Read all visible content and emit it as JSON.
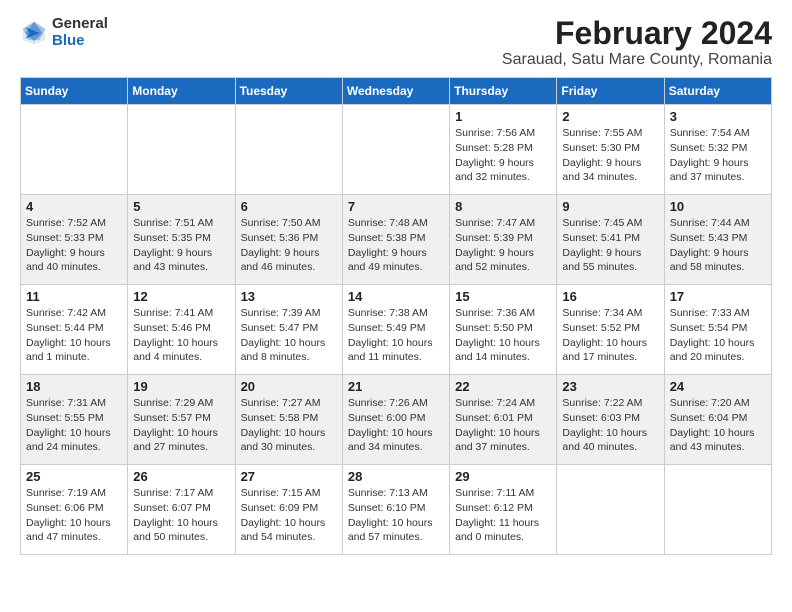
{
  "logo": {
    "general": "General",
    "blue": "Blue"
  },
  "title": "February 2024",
  "subtitle": "Sarauad, Satu Mare County, Romania",
  "days_of_week": [
    "Sunday",
    "Monday",
    "Tuesday",
    "Wednesday",
    "Thursday",
    "Friday",
    "Saturday"
  ],
  "weeks": [
    [
      {
        "day": "",
        "info": ""
      },
      {
        "day": "",
        "info": ""
      },
      {
        "day": "",
        "info": ""
      },
      {
        "day": "",
        "info": ""
      },
      {
        "day": "1",
        "info": "Sunrise: 7:56 AM\nSunset: 5:28 PM\nDaylight: 9 hours\nand 32 minutes."
      },
      {
        "day": "2",
        "info": "Sunrise: 7:55 AM\nSunset: 5:30 PM\nDaylight: 9 hours\nand 34 minutes."
      },
      {
        "day": "3",
        "info": "Sunrise: 7:54 AM\nSunset: 5:32 PM\nDaylight: 9 hours\nand 37 minutes."
      }
    ],
    [
      {
        "day": "4",
        "info": "Sunrise: 7:52 AM\nSunset: 5:33 PM\nDaylight: 9 hours\nand 40 minutes."
      },
      {
        "day": "5",
        "info": "Sunrise: 7:51 AM\nSunset: 5:35 PM\nDaylight: 9 hours\nand 43 minutes."
      },
      {
        "day": "6",
        "info": "Sunrise: 7:50 AM\nSunset: 5:36 PM\nDaylight: 9 hours\nand 46 minutes."
      },
      {
        "day": "7",
        "info": "Sunrise: 7:48 AM\nSunset: 5:38 PM\nDaylight: 9 hours\nand 49 minutes."
      },
      {
        "day": "8",
        "info": "Sunrise: 7:47 AM\nSunset: 5:39 PM\nDaylight: 9 hours\nand 52 minutes."
      },
      {
        "day": "9",
        "info": "Sunrise: 7:45 AM\nSunset: 5:41 PM\nDaylight: 9 hours\nand 55 minutes."
      },
      {
        "day": "10",
        "info": "Sunrise: 7:44 AM\nSunset: 5:43 PM\nDaylight: 9 hours\nand 58 minutes."
      }
    ],
    [
      {
        "day": "11",
        "info": "Sunrise: 7:42 AM\nSunset: 5:44 PM\nDaylight: 10 hours\nand 1 minute."
      },
      {
        "day": "12",
        "info": "Sunrise: 7:41 AM\nSunset: 5:46 PM\nDaylight: 10 hours\nand 4 minutes."
      },
      {
        "day": "13",
        "info": "Sunrise: 7:39 AM\nSunset: 5:47 PM\nDaylight: 10 hours\nand 8 minutes."
      },
      {
        "day": "14",
        "info": "Sunrise: 7:38 AM\nSunset: 5:49 PM\nDaylight: 10 hours\nand 11 minutes."
      },
      {
        "day": "15",
        "info": "Sunrise: 7:36 AM\nSunset: 5:50 PM\nDaylight: 10 hours\nand 14 minutes."
      },
      {
        "day": "16",
        "info": "Sunrise: 7:34 AM\nSunset: 5:52 PM\nDaylight: 10 hours\nand 17 minutes."
      },
      {
        "day": "17",
        "info": "Sunrise: 7:33 AM\nSunset: 5:54 PM\nDaylight: 10 hours\nand 20 minutes."
      }
    ],
    [
      {
        "day": "18",
        "info": "Sunrise: 7:31 AM\nSunset: 5:55 PM\nDaylight: 10 hours\nand 24 minutes."
      },
      {
        "day": "19",
        "info": "Sunrise: 7:29 AM\nSunset: 5:57 PM\nDaylight: 10 hours\nand 27 minutes."
      },
      {
        "day": "20",
        "info": "Sunrise: 7:27 AM\nSunset: 5:58 PM\nDaylight: 10 hours\nand 30 minutes."
      },
      {
        "day": "21",
        "info": "Sunrise: 7:26 AM\nSunset: 6:00 PM\nDaylight: 10 hours\nand 34 minutes."
      },
      {
        "day": "22",
        "info": "Sunrise: 7:24 AM\nSunset: 6:01 PM\nDaylight: 10 hours\nand 37 minutes."
      },
      {
        "day": "23",
        "info": "Sunrise: 7:22 AM\nSunset: 6:03 PM\nDaylight: 10 hours\nand 40 minutes."
      },
      {
        "day": "24",
        "info": "Sunrise: 7:20 AM\nSunset: 6:04 PM\nDaylight: 10 hours\nand 43 minutes."
      }
    ],
    [
      {
        "day": "25",
        "info": "Sunrise: 7:19 AM\nSunset: 6:06 PM\nDaylight: 10 hours\nand 47 minutes."
      },
      {
        "day": "26",
        "info": "Sunrise: 7:17 AM\nSunset: 6:07 PM\nDaylight: 10 hours\nand 50 minutes."
      },
      {
        "day": "27",
        "info": "Sunrise: 7:15 AM\nSunset: 6:09 PM\nDaylight: 10 hours\nand 54 minutes."
      },
      {
        "day": "28",
        "info": "Sunrise: 7:13 AM\nSunset: 6:10 PM\nDaylight: 10 hours\nand 57 minutes."
      },
      {
        "day": "29",
        "info": "Sunrise: 7:11 AM\nSunset: 6:12 PM\nDaylight: 11 hours\nand 0 minutes."
      },
      {
        "day": "",
        "info": ""
      },
      {
        "day": "",
        "info": ""
      }
    ]
  ]
}
